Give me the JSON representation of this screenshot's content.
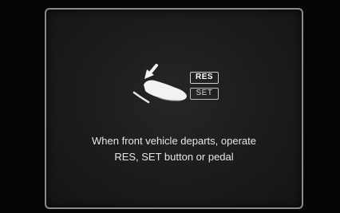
{
  "icons": {
    "pedal": "foot-on-pedal-icon",
    "arrow": "press-arrow-icon"
  },
  "buttons": {
    "res_label": "RES",
    "set_label": "SET"
  },
  "message": {
    "line1": "When front vehicle departs, operate",
    "line2": "RES, SET button or pedal"
  },
  "colors": {
    "panel_border": "#8a8a8a",
    "text": "#e6e6e6",
    "background": "#050505"
  }
}
